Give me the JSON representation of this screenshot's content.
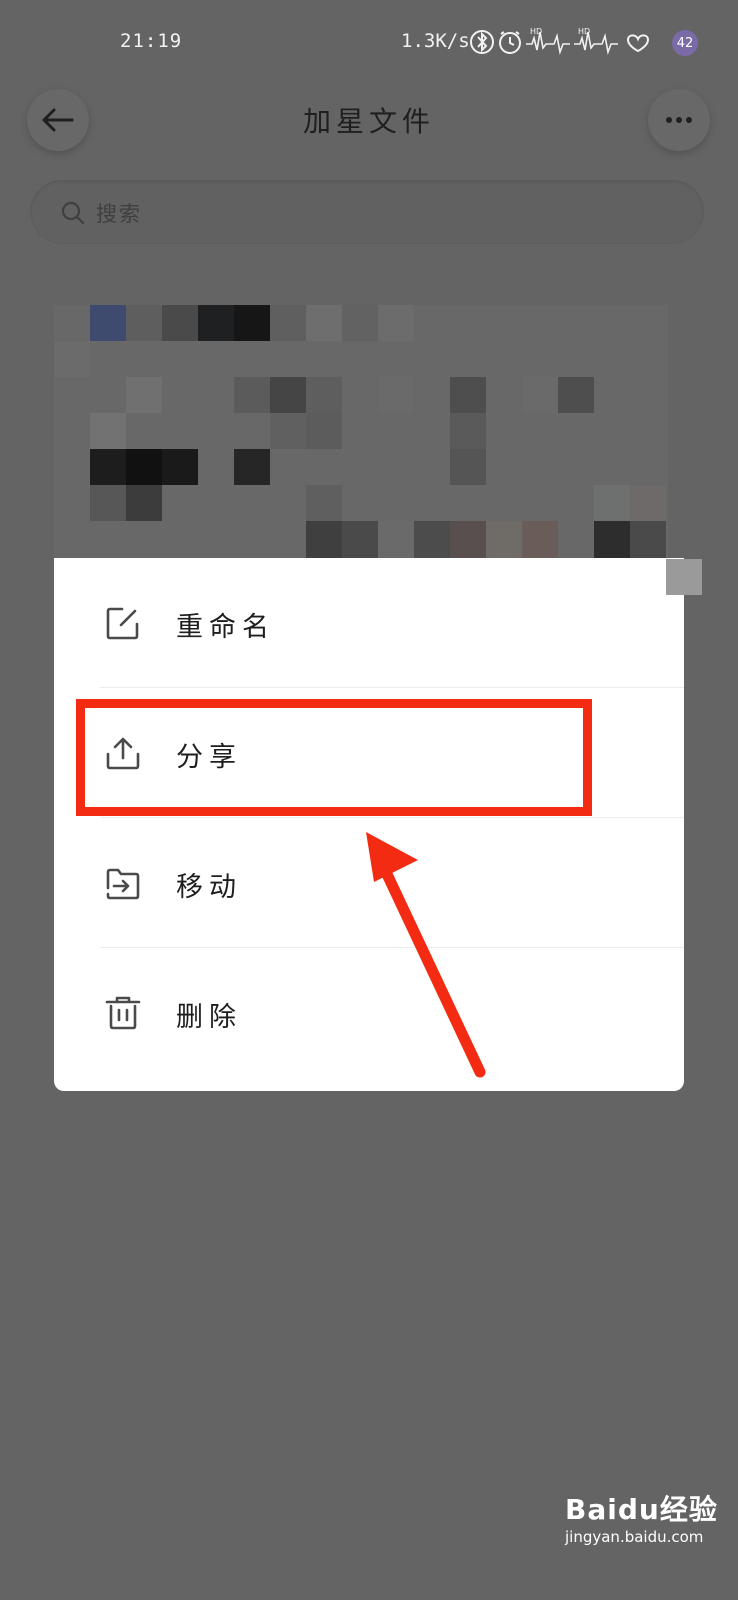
{
  "status_bar": {
    "time": "21:19",
    "net_speed": "1.3K/s",
    "badge_count": "42",
    "icons": [
      "bluetooth-icon",
      "alarm-icon",
      "hd-signal-icon",
      "hd-signal-icon",
      "heart-icon"
    ]
  },
  "header": {
    "title": "加星文件",
    "back_icon": "arrow-left-icon",
    "more_icon": "more-dots-icon"
  },
  "search": {
    "placeholder": "搜索",
    "icon": "search-icon"
  },
  "menu": {
    "items": [
      {
        "label": "重命名",
        "icon": "rename-icon"
      },
      {
        "label": "分享",
        "icon": "share-icon"
      },
      {
        "label": "移动",
        "icon": "move-icon"
      },
      {
        "label": "删除",
        "icon": "delete-icon"
      }
    ],
    "highlighted_index": 1
  },
  "annotation": {
    "color": "#f32b13"
  },
  "watermark": {
    "logo_prefix": "Bai",
    "logo_paw": "du",
    "logo_suffix": "经验",
    "url": "jingyan.baidu.com"
  },
  "colors": {
    "overlay_bg": "#646464",
    "menu_bg": "#ffffff",
    "text": "#1e1e1e"
  }
}
